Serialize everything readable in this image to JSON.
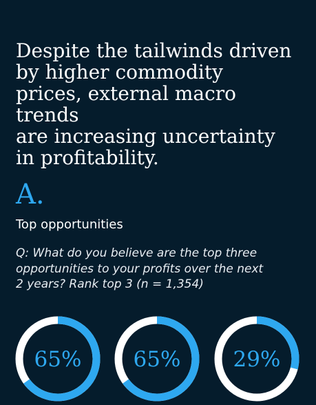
{
  "headline": "Despite the tailwinds driven\nby higher commodity\nprices, external macro trends\nare increasing uncertainty\nin profitability.",
  "section": {
    "letter": "A.",
    "title": "Top opportunities",
    "question": "Q: What do you believe are the top three\nopportunities to your profits over the next\n2 years? Rank top 3 (n = 1,354)"
  },
  "colors": {
    "background": "#051c2c",
    "accent": "#2ea8f0",
    "ring_remainder": "#ffffff"
  },
  "chart_data": {
    "type": "pie",
    "series": [
      {
        "label": "65%",
        "value": 65
      },
      {
        "label": "65%",
        "value": 65
      },
      {
        "label": "29%",
        "value": 29
      }
    ]
  }
}
